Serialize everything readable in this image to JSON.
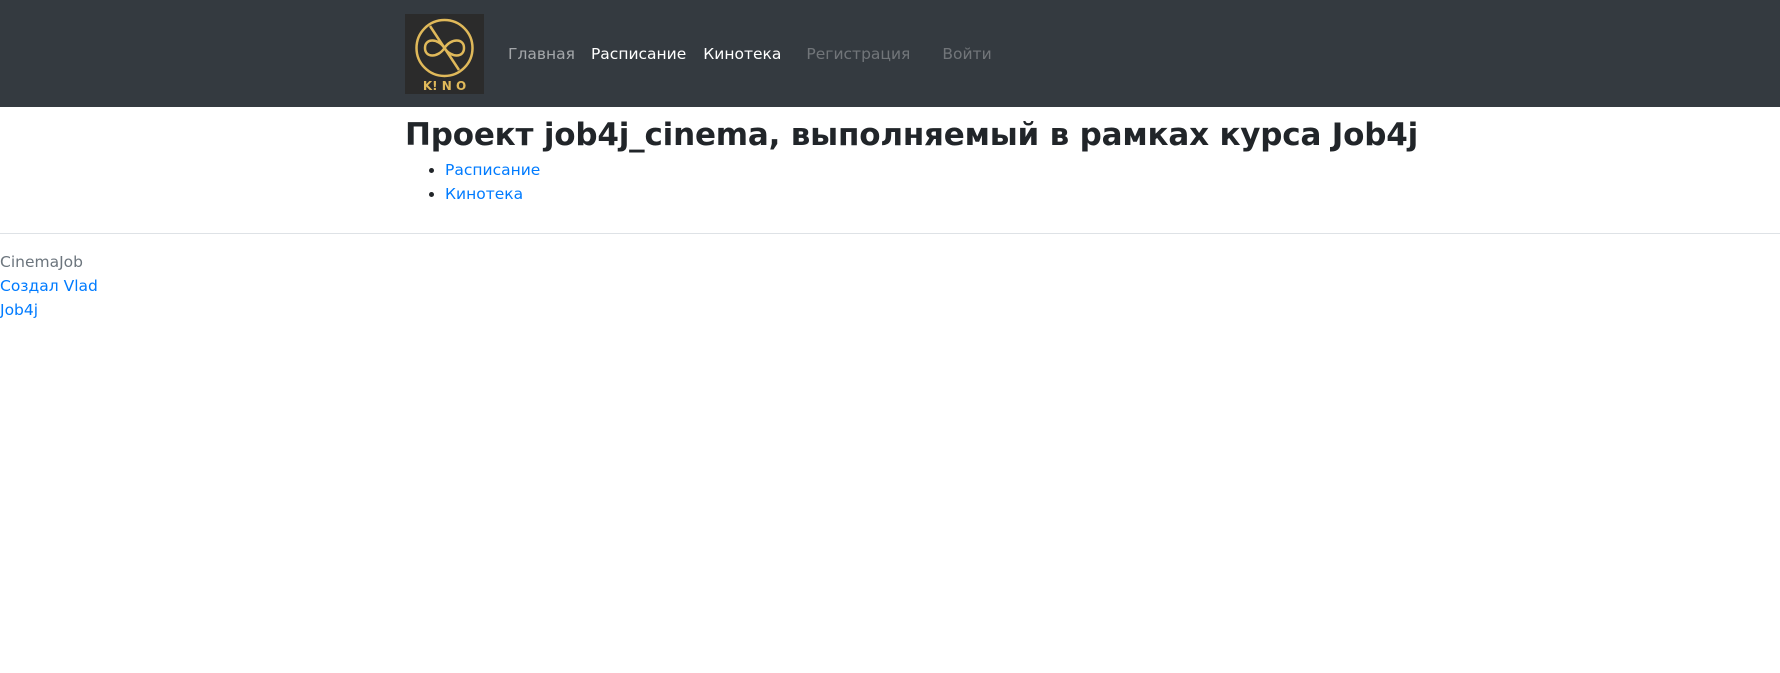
{
  "navbar": {
    "logo": {
      "icon": "kino-infinity-logo-icon",
      "text": "K! N O",
      "color": "#e0b95a"
    },
    "links": {
      "home": "Главная",
      "schedule": "Расписание",
      "films": "Кинотека",
      "register": "Регистрация",
      "login": "Войти"
    }
  },
  "main": {
    "title": "Проект job4j_cinema, выполняемый в рамках курса Job4j",
    "links": [
      "Расписание",
      "Кинотека"
    ]
  },
  "footer": {
    "brand": "CinemaJob",
    "author_link": "Создал Vlad",
    "course_link": "Job4j"
  },
  "colors": {
    "navbar_bg": "#343a40",
    "link": "#007bff",
    "muted": "#6c757d"
  }
}
